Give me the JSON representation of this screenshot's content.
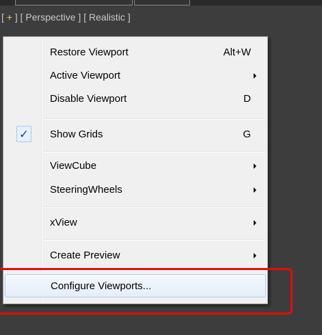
{
  "viewport_label": {
    "plus": "+",
    "view": "Perspective",
    "shading": "Realistic"
  },
  "menu": {
    "items": [
      {
        "label": "Restore Viewport",
        "shortcut": "Alt+W",
        "submenu": false,
        "checked": false
      },
      {
        "label": "Active Viewport",
        "shortcut": "",
        "submenu": true,
        "checked": false
      },
      {
        "label": "Disable Viewport",
        "shortcut": "D",
        "submenu": false,
        "checked": false
      },
      {
        "label": "Show Grids",
        "shortcut": "G",
        "submenu": false,
        "checked": true,
        "check_glyph": "✓"
      },
      {
        "label": "ViewCube",
        "shortcut": "",
        "submenu": true,
        "checked": false
      },
      {
        "label": "SteeringWheels",
        "shortcut": "",
        "submenu": true,
        "checked": false
      },
      {
        "label": "xView",
        "shortcut": "",
        "submenu": true,
        "checked": false
      },
      {
        "label": "Create Preview",
        "shortcut": "",
        "submenu": true,
        "checked": false
      },
      {
        "label": "Configure Viewports...",
        "shortcut": "",
        "submenu": false,
        "checked": false,
        "highlighted": true
      }
    ]
  },
  "colors": {
    "annotation": "#e60b0b",
    "check": "#1e3fa8"
  }
}
